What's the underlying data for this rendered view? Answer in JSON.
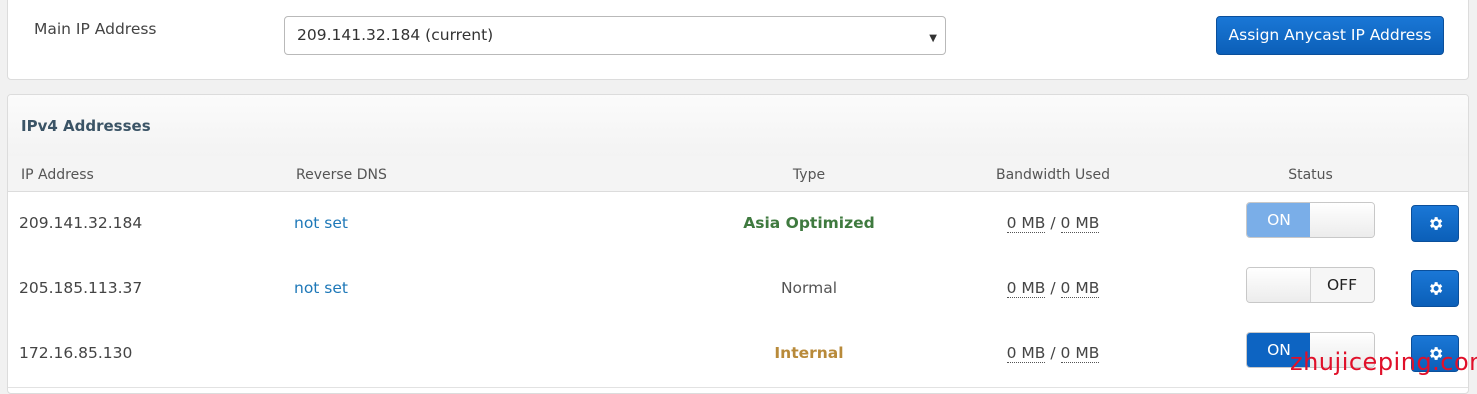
{
  "main_ip": {
    "label": "Main IP Address",
    "selected": "209.141.32.184 (current)",
    "assign_button": "Assign Anycast IP Address"
  },
  "ipv4": {
    "title": "IPv4 Addresses",
    "columns": [
      "IP Address",
      "Reverse DNS",
      "Type",
      "Bandwidth Used",
      "Status"
    ],
    "rows": [
      {
        "ip": "209.141.32.184",
        "rdns": "not set",
        "type": "Asia Optimized",
        "bw_used": "0 MB",
        "bw_sep": "/",
        "bw_total": "0 MB",
        "status": "ON"
      },
      {
        "ip": "205.185.113.37",
        "rdns": "not set",
        "type": "Normal",
        "bw_used": "0 MB",
        "bw_sep": "/",
        "bw_total": "0 MB",
        "status": "OFF"
      },
      {
        "ip": "172.16.85.130",
        "rdns": "",
        "type": "Internal",
        "bw_used": "0 MB",
        "bw_sep": "/",
        "bw_total": "0 MB",
        "status": "ON"
      }
    ]
  },
  "icons": {
    "settings": "gear-icon",
    "dropdown": "caret-down-icon"
  },
  "watermark": "zhujiceping.com",
  "colors": {
    "accent": "#0b5fb8",
    "link": "#1e78b8",
    "asia": "#3f7a3f",
    "internal": "#b88a3a"
  }
}
